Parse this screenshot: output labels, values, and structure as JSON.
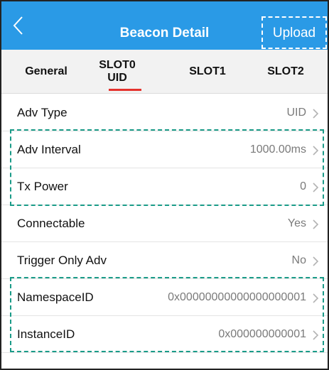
{
  "header": {
    "title": "Beacon Detail",
    "upload_label": "Upload",
    "back_icon": "chevron-left-icon"
  },
  "tabs": [
    {
      "line1": "General",
      "line2": "",
      "selected": false
    },
    {
      "line1": "SLOT0",
      "line2": "UID",
      "selected": true
    },
    {
      "line1": "SLOT1",
      "line2": "",
      "selected": false
    },
    {
      "line1": "SLOT2",
      "line2": "",
      "selected": false
    }
  ],
  "rows": [
    {
      "label": "Adv Type",
      "value": "UID"
    },
    {
      "label": "Adv Interval",
      "value": "1000.00ms"
    },
    {
      "label": "Tx Power",
      "value": "0"
    },
    {
      "label": "Connectable",
      "value": "Yes"
    },
    {
      "label": "Trigger Only Adv",
      "value": "No"
    },
    {
      "label": "NamespaceID",
      "value": "0x00000000000000000001"
    },
    {
      "label": "InstanceID",
      "value": "0x000000000001"
    }
  ],
  "colors": {
    "navbar": "#2a9ae6",
    "tab_underline": "#e5322d",
    "highlight_box": "#1a9b88"
  }
}
